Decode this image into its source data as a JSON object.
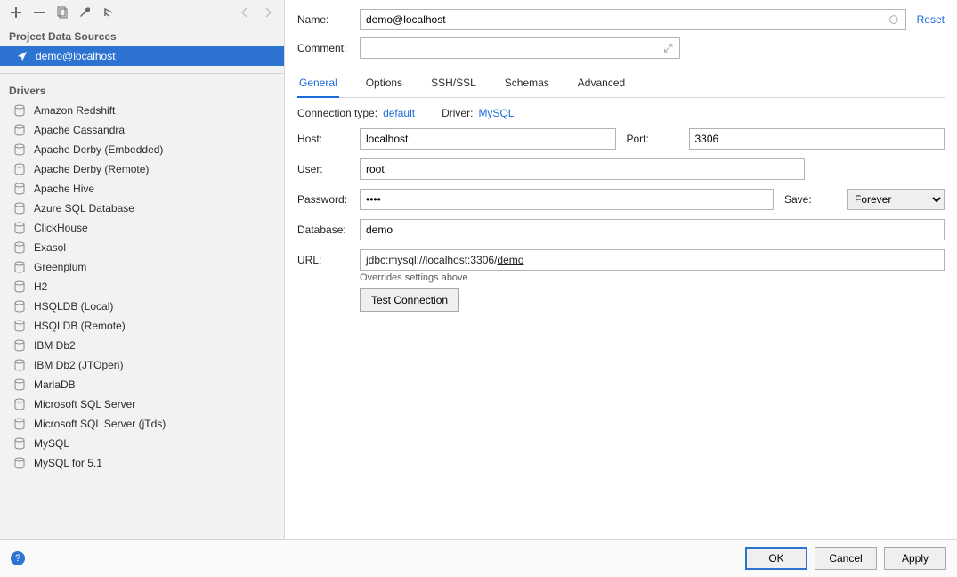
{
  "sidebar": {
    "sections": {
      "data_sources_title": "Project Data Sources",
      "drivers_title": "Drivers"
    },
    "data_sources": [
      {
        "label": "demo@localhost",
        "selected": true
      }
    ],
    "drivers": [
      "Amazon Redshift",
      "Apache Cassandra",
      "Apache Derby (Embedded)",
      "Apache Derby (Remote)",
      "Apache Hive",
      "Azure SQL Database",
      "ClickHouse",
      "Exasol",
      "Greenplum",
      "H2",
      "HSQLDB (Local)",
      "HSQLDB (Remote)",
      "IBM Db2",
      "IBM Db2 (JTOpen)",
      "MariaDB",
      "Microsoft SQL Server",
      "Microsoft SQL Server (jTds)",
      "MySQL",
      "MySQL for 5.1"
    ]
  },
  "header": {
    "name_label": "Name:",
    "name_value": "demo@localhost",
    "comment_label": "Comment:",
    "comment_value": "",
    "reset": "Reset"
  },
  "tabs": [
    "General",
    "Options",
    "SSH/SSL",
    "Schemas",
    "Advanced"
  ],
  "active_tab": "General",
  "meta": {
    "conn_type_label": "Connection type:",
    "conn_type_value": "default",
    "driver_label": "Driver:",
    "driver_value": "MySQL"
  },
  "form": {
    "host_label": "Host:",
    "host_value": "localhost",
    "port_label": "Port:",
    "port_value": "3306",
    "user_label": "User:",
    "user_value": "root",
    "password_label": "Password:",
    "password_value": "••••",
    "save_label": "Save:",
    "save_value": "Forever",
    "database_label": "Database:",
    "database_value": "demo",
    "url_label": "URL:",
    "url_prefix": "jdbc:mysql://localhost:3306/",
    "url_db": "demo",
    "url_note": "Overrides settings above",
    "test_btn": "Test Connection"
  },
  "footer": {
    "ok": "OK",
    "cancel": "Cancel",
    "apply": "Apply"
  }
}
